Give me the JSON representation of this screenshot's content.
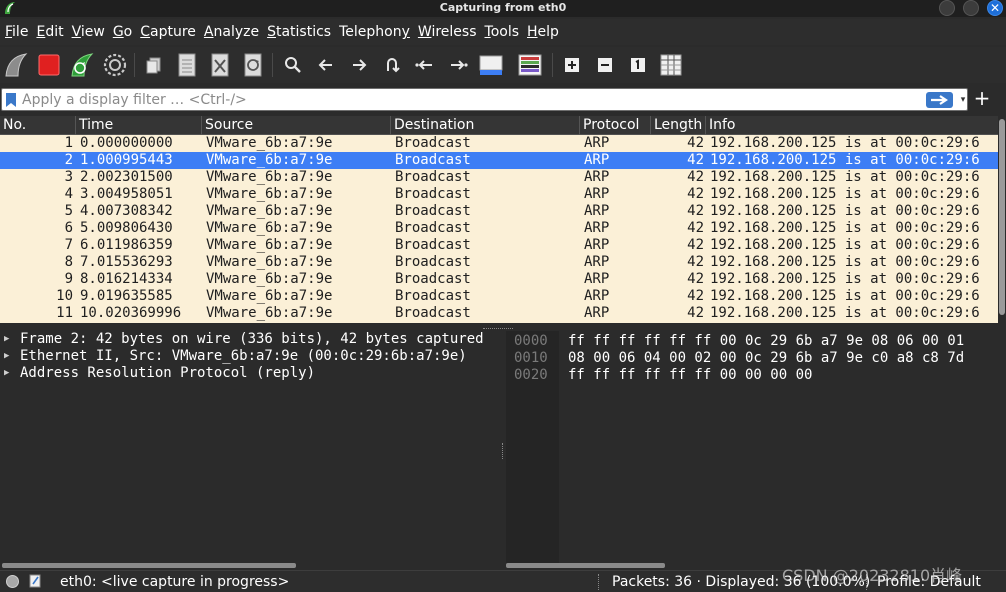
{
  "window": {
    "title": "Capturing from eth0",
    "close_glyph": "✕"
  },
  "menu": [
    {
      "key": "F",
      "rest": "ile"
    },
    {
      "key": "E",
      "rest": "dit"
    },
    {
      "key": "V",
      "rest": "iew"
    },
    {
      "key": "G",
      "rest": "o"
    },
    {
      "key": "C",
      "rest": "apture"
    },
    {
      "key": "A",
      "rest": "nalyze"
    },
    {
      "key": "S",
      "rest": "tatistics"
    },
    {
      "key": "",
      "rest": "Telephon",
      "post": "y",
      "underline_post": true
    },
    {
      "key": "W",
      "rest": "ireless"
    },
    {
      "key": "T",
      "rest": "ools"
    },
    {
      "key": "H",
      "rest": "elp"
    }
  ],
  "toolbar_icons": [
    "shark-fin-start-icon",
    "stop-capture-icon",
    "restart-capture-icon",
    "capture-options-icon",
    "open-file-icon",
    "save-file-icon",
    "close-file-icon",
    "reload-file-icon",
    "find-packet-icon",
    "go-back-icon",
    "go-forward-icon",
    "go-to-packet-icon",
    "first-packet-icon",
    "last-packet-icon",
    "autoscroll-icon",
    "colorize-icon",
    "zoom-in-icon",
    "zoom-out-icon",
    "normal-size-icon",
    "resize-columns-icon"
  ],
  "filter": {
    "placeholder": "Apply a display filter … <Ctrl-/>",
    "dropdown_glyph": "▾",
    "add_glyph": "+"
  },
  "packet_list": {
    "columns": [
      "No.",
      "Time",
      "Source",
      "Destination",
      "Protocol",
      "Length",
      "Info"
    ],
    "selected_index": 1,
    "rows": [
      {
        "no": "1",
        "time": "0.000000000",
        "source": "VMware_6b:a7:9e",
        "destination": "Broadcast",
        "protocol": "ARP",
        "length": "42",
        "info": "192.168.200.125 is at 00:0c:29:6"
      },
      {
        "no": "2",
        "time": "1.000995443",
        "source": "VMware_6b:a7:9e",
        "destination": "Broadcast",
        "protocol": "ARP",
        "length": "42",
        "info": "192.168.200.125 is at 00:0c:29:6"
      },
      {
        "no": "3",
        "time": "2.002301500",
        "source": "VMware_6b:a7:9e",
        "destination": "Broadcast",
        "protocol": "ARP",
        "length": "42",
        "info": "192.168.200.125 is at 00:0c:29:6"
      },
      {
        "no": "4",
        "time": "3.004958051",
        "source": "VMware_6b:a7:9e",
        "destination": "Broadcast",
        "protocol": "ARP",
        "length": "42",
        "info": "192.168.200.125 is at 00:0c:29:6"
      },
      {
        "no": "5",
        "time": "4.007308342",
        "source": "VMware_6b:a7:9e",
        "destination": "Broadcast",
        "protocol": "ARP",
        "length": "42",
        "info": "192.168.200.125 is at 00:0c:29:6"
      },
      {
        "no": "6",
        "time": "5.009806430",
        "source": "VMware_6b:a7:9e",
        "destination": "Broadcast",
        "protocol": "ARP",
        "length": "42",
        "info": "192.168.200.125 is at 00:0c:29:6"
      },
      {
        "no": "7",
        "time": "6.011986359",
        "source": "VMware_6b:a7:9e",
        "destination": "Broadcast",
        "protocol": "ARP",
        "length": "42",
        "info": "192.168.200.125 is at 00:0c:29:6"
      },
      {
        "no": "8",
        "time": "7.015536293",
        "source": "VMware_6b:a7:9e",
        "destination": "Broadcast",
        "protocol": "ARP",
        "length": "42",
        "info": "192.168.200.125 is at 00:0c:29:6"
      },
      {
        "no": "9",
        "time": "8.016214334",
        "source": "VMware_6b:a7:9e",
        "destination": "Broadcast",
        "protocol": "ARP",
        "length": "42",
        "info": "192.168.200.125 is at 00:0c:29:6"
      },
      {
        "no": "10",
        "time": "9.019635585",
        "source": "VMware_6b:a7:9e",
        "destination": "Broadcast",
        "protocol": "ARP",
        "length": "42",
        "info": "192.168.200.125 is at 00:0c:29:6"
      },
      {
        "no": "11",
        "time": "10.020369996",
        "source": "VMware_6b:a7:9e",
        "destination": "Broadcast",
        "protocol": "ARP",
        "length": "42",
        "info": "192.168.200.125 is at 00:0c:29:6"
      }
    ]
  },
  "details": [
    "Frame 2: 42 bytes on wire (336 bits), 42 bytes captured",
    "Ethernet II, Src: VMware_6b:a7:9e (00:0c:29:6b:a7:9e)",
    "Address Resolution Protocol (reply)"
  ],
  "bytes": [
    {
      "offset": "0000",
      "hex": "ff ff ff ff ff ff 00 0c  29 6b a7 9e 08 06 00 01"
    },
    {
      "offset": "0010",
      "hex": "08 00 06 04 00 02 00 0c  29 6b a7 9e c0 a8 c8 7d"
    },
    {
      "offset": "0020",
      "hex": "ff ff ff ff ff ff 00 00  00 00"
    }
  ],
  "status": {
    "capture_text": "eth0: <live capture in progress>",
    "packets_text": "Packets: 36 · Displayed: 36 (100.0%)",
    "profile_text": "Profile: Default"
  },
  "watermark": "CSDN @20232810肖峰",
  "colors": {
    "row_bg": "#fbf0d7",
    "selected_bg": "#3d7ef5",
    "window_bg": "#2b2b2b"
  }
}
